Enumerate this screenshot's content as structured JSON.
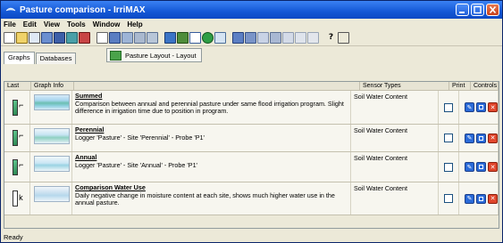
{
  "window": {
    "title": "Pasture comparison - IrriMAX"
  },
  "menu": [
    "File",
    "Edit",
    "View",
    "Tools",
    "Window",
    "Help"
  ],
  "tabs": [
    {
      "label": "Graphs"
    },
    {
      "label": "Databases"
    }
  ],
  "layout_button": {
    "label": "Pasture Layout - Layout"
  },
  "columns": {
    "last": "Last",
    "graph_info": "Graph Info",
    "sensor_types": "Sensor Types",
    "print": "Print",
    "controls": "Controls"
  },
  "rows": [
    {
      "title": "Summed",
      "description": "Comparison between annual and perennial pasture under same flood irrigation program. Slight difference in irrigation time due to position in program.",
      "sensor": "Soil Water Content"
    },
    {
      "title": "Perennial",
      "description": "Logger 'Pasture' - Site 'Perennial' - Probe 'P1'",
      "sensor": "Soil Water Content"
    },
    {
      "title": "Annual",
      "description": "Logger 'Pasture' - Site 'Annual' - Probe 'P1'",
      "sensor": "Soil Water Content"
    },
    {
      "title": "Comparison Water Use",
      "description": "Daily negative change in moisture content at each site, shows much higher water use in the annual pasture.",
      "sensor": "Soil Water Content"
    }
  ],
  "status": "Ready",
  "colors": {
    "titlebar": "#1458d6",
    "accent": "#2a6ad8",
    "delete": "#e0462c"
  }
}
